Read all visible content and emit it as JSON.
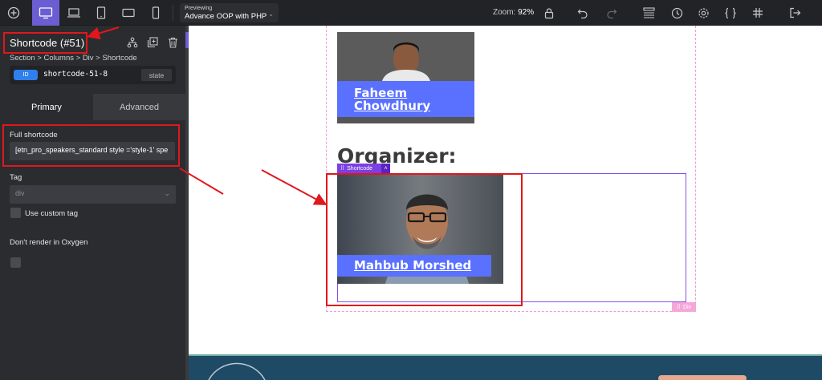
{
  "toolbar": {
    "preview_label": "Previewing",
    "preview_value": "Advance OOP with PHP",
    "zoom_label": "Zoom:",
    "zoom_value": "92%"
  },
  "panel": {
    "element_title": "Shortcode (#51)",
    "breadcrumb": "Section > Columns > Div > Shortcode",
    "id_badge": "ID",
    "id_value": "shortcode-51-8",
    "state_button": "state",
    "tabs": {
      "primary": "Primary",
      "advanced": "Advanced"
    },
    "full_shortcode_label": "Full shortcode",
    "full_shortcode_value": "[etn_pro_speakers_standard style ='style-1' spe",
    "tag_label": "Tag",
    "tag_value": "div",
    "custom_tag_label": "Use custom tag",
    "dont_render_label": "Don't render in Oxygen"
  },
  "canvas": {
    "speaker1_name": "Faheem Chowdhury",
    "organizer_heading": "Organizer:",
    "speaker2_name": "Mahbub Morshed",
    "shortcode_tag_label": "Shortcode",
    "div_tag_label": "Div"
  },
  "colors": {
    "accent": "#6b5ed3",
    "name_band": "#5a70ff",
    "annotation_red": "#e0171c",
    "shortcode_outline": "#8a4ee6",
    "div_outline": "#f29ad1"
  }
}
